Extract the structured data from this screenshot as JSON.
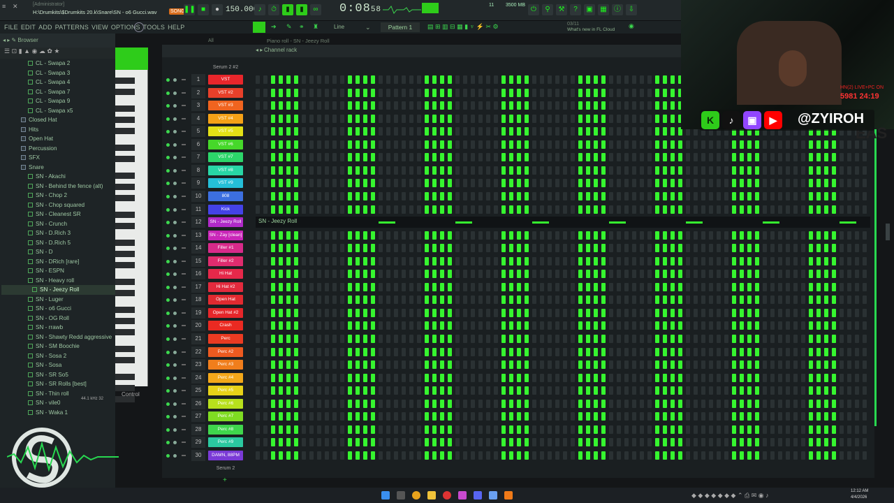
{
  "titlebar": {
    "user": "[Administrator]",
    "path": "H:\\Drumkits\\$Drumkits 20.k\\Snare\\SN - o6 Gucci.wav",
    "tempo": "150.000",
    "time": "0:08",
    "time_small": "58",
    "memory": "3500 MB",
    "cpu": "11",
    "song_badge": "SONG"
  },
  "menu": [
    "FILE",
    "EDIT",
    "ADD",
    "PATTERNS",
    "VIEW",
    "OPTIONS",
    "TOOLS",
    "HELP"
  ],
  "toolbar": {
    "pattern": "Pattern 1",
    "line_mode": "Line",
    "news_date": "03/11",
    "news": "What's new in FL Cloud Pro?"
  },
  "browser": {
    "title": "Browser",
    "items": [
      {
        "label": "CL - Swapa 2",
        "type": "file"
      },
      {
        "label": "CL - Swapa 3",
        "type": "file"
      },
      {
        "label": "CL - Swapa 4",
        "type": "file"
      },
      {
        "label": "CL - Swapa 7",
        "type": "file"
      },
      {
        "label": "CL - Swapa 9",
        "type": "file"
      },
      {
        "label": "CL - Swapa x5",
        "type": "file"
      },
      {
        "label": "Closed Hat",
        "type": "folder"
      },
      {
        "label": "Hits",
        "type": "folder"
      },
      {
        "label": "Open Hat",
        "type": "folder"
      },
      {
        "label": "Percussion",
        "type": "folder"
      },
      {
        "label": "SFX",
        "type": "folder"
      },
      {
        "label": "Snare",
        "type": "folder"
      },
      {
        "label": "SN - Akachi",
        "type": "file"
      },
      {
        "label": "SN - Behind the fence (alt)",
        "type": "file"
      },
      {
        "label": "SN - Chop 2",
        "type": "file"
      },
      {
        "label": "SN - Chop squared",
        "type": "file"
      },
      {
        "label": "SN - Cleanest SR",
        "type": "file"
      },
      {
        "label": "SN - Crunch",
        "type": "file"
      },
      {
        "label": "SN - D.Rich 3",
        "type": "file"
      },
      {
        "label": "SN - D.Rich 5",
        "type": "file"
      },
      {
        "label": "SN - D",
        "type": "file"
      },
      {
        "label": "SN - DRich [rare]",
        "type": "file"
      },
      {
        "label": "SN - ESPN",
        "type": "file"
      },
      {
        "label": "SN - Heavy roll",
        "type": "file"
      },
      {
        "label": "SN - Jeezy Roll",
        "type": "selected"
      },
      {
        "label": "SN - Luger",
        "type": "file"
      },
      {
        "label": "SN - o6 Gucci",
        "type": "file"
      },
      {
        "label": "SN - OG Roll",
        "type": "file"
      },
      {
        "label": "SN - rrawb",
        "type": "file"
      },
      {
        "label": "SN - Shawty Redd aggressive",
        "type": "file"
      },
      {
        "label": "SN - SM Boochie",
        "type": "file"
      },
      {
        "label": "SN - Sosa 2",
        "type": "file"
      },
      {
        "label": "SN - Sosa",
        "type": "file"
      },
      {
        "label": "SN - SR So5",
        "type": "file"
      },
      {
        "label": "SN - SR Rolls [best]",
        "type": "file"
      },
      {
        "label": "SN - Thin roll",
        "type": "file"
      },
      {
        "label": "SN - vile0",
        "type": "file"
      },
      {
        "label": "SN - Waka 1",
        "type": "file"
      }
    ],
    "sample_info": "44.1 kHz 32"
  },
  "rack": {
    "title": "Channel rack",
    "pianoroll": "Piano roll - SN - Jeezy Roll",
    "filter": "All",
    "top_channel": "Serum 2 #2",
    "bottom_channel": "Serum 2",
    "control": "Control",
    "jeezy_label": "SN - Jeezy Roll",
    "channels": [
      {
        "n": "1",
        "name": "VST",
        "color": "#e8262b"
      },
      {
        "n": "2",
        "name": "VST #2",
        "color": "#e8402a"
      },
      {
        "n": "3",
        "name": "VST #3",
        "color": "#f0641f"
      },
      {
        "n": "4",
        "name": "VST #4",
        "color": "#f5a117"
      },
      {
        "n": "5",
        "name": "VST #5",
        "color": "#e3e016"
      },
      {
        "n": "6",
        "name": "VST #6",
        "color": "#46d82a"
      },
      {
        "n": "7",
        "name": "VST #7",
        "color": "#2cd66a"
      },
      {
        "n": "8",
        "name": "VST #8",
        "color": "#28d6a6"
      },
      {
        "n": "9",
        "name": "VST #9",
        "color": "#25bfd8"
      },
      {
        "n": "10",
        "name": "808",
        "color": "#3c6fe0"
      },
      {
        "n": "11",
        "name": "Kick",
        "color": "#4442e8"
      },
      {
        "n": "12",
        "name": "SN - Jeezy Roll",
        "color": "#b02ac8"
      },
      {
        "n": "13",
        "name": "SN - Zay [clean]",
        "color": "#c926b8"
      },
      {
        "n": "14",
        "name": "Filler #1",
        "color": "#d82a8a"
      },
      {
        "n": "15",
        "name": "Filler #2",
        "color": "#e02c6e"
      },
      {
        "n": "16",
        "name": "Hi Hat",
        "color": "#e6284a"
      },
      {
        "n": "17",
        "name": "Hi Hat #2",
        "color": "#e32a3d"
      },
      {
        "n": "18",
        "name": "Open Hat",
        "color": "#e22a30"
      },
      {
        "n": "19",
        "name": "Open Hat #2",
        "color": "#e6262a"
      },
      {
        "n": "20",
        "name": "Crash",
        "color": "#ea2a22"
      },
      {
        "n": "21",
        "name": "Perc",
        "color": "#eb3b22"
      },
      {
        "n": "22",
        "name": "Perc #2",
        "color": "#ed5a20"
      },
      {
        "n": "23",
        "name": "Perc #3",
        "color": "#f07e1c"
      },
      {
        "n": "24",
        "name": "Perc #4",
        "color": "#f3a81a"
      },
      {
        "n": "25",
        "name": "Perc #5",
        "color": "#e8d218"
      },
      {
        "n": "26",
        "name": "Perc #6",
        "color": "#b8e01c"
      },
      {
        "n": "27",
        "name": "Perc #7",
        "color": "#7fdc22"
      },
      {
        "n": "28",
        "name": "Perc #8",
        "color": "#3fd64c"
      },
      {
        "n": "29",
        "name": "Perc #9",
        "color": "#2bc9a0"
      },
      {
        "n": "30",
        "name": "DAMN, 88PM",
        "color": "#7a3ad6"
      }
    ]
  },
  "stream": {
    "handle": "@ZYIROH",
    "live_text": "HN(2) LIVE+PC ON",
    "counter": "5981 24:19",
    "overlay_text": "EAS"
  },
  "taskbar": {
    "time": "12:12 AM",
    "date": "4/4/2026"
  }
}
